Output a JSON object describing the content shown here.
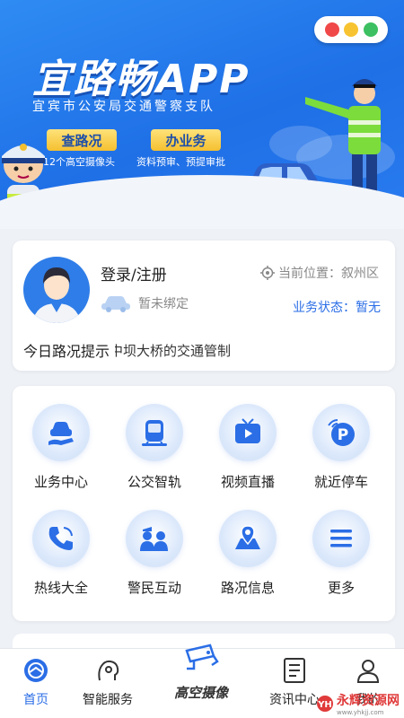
{
  "banner": {
    "title": "宜路畅APP",
    "subtitle": "宜宾市公安局交通警察支队",
    "badges": [
      {
        "label": "查路况",
        "note": "12个高空摄像头"
      },
      {
        "label": "办业务",
        "note": "资料预审、预提审批"
      }
    ],
    "carousel": {
      "count": 3,
      "active": 0
    },
    "colors": {
      "accent": "#2b6ee6",
      "badge": "#f4c030"
    }
  },
  "user": {
    "login_label": "登录/注册",
    "location_label": "当前位置：叙州区",
    "car_status": "暂未绑定",
    "business_status": "业务状态：暂无"
  },
  "notice": {
    "label": "今日路况提示",
    "text": "中坝大桥的交通管制"
  },
  "services": [
    {
      "label": "业务中心",
      "icon": "car-service-icon"
    },
    {
      "label": "公交智轨",
      "icon": "bus-icon"
    },
    {
      "label": "视频直播",
      "icon": "tv-icon"
    },
    {
      "label": "就近停车",
      "icon": "parking-icon"
    },
    {
      "label": "热线大全",
      "icon": "phone-icon"
    },
    {
      "label": "警民互动",
      "icon": "police-interaction-icon"
    },
    {
      "label": "路况信息",
      "icon": "map-pin-icon"
    },
    {
      "label": "更多",
      "icon": "menu-icon"
    }
  ],
  "nav": [
    {
      "label": "首页",
      "icon": "home-icon",
      "active": true
    },
    {
      "label": "智能服务",
      "icon": "smart-service-icon"
    },
    {
      "label": "高空摄像",
      "icon": "camera-icon"
    },
    {
      "label": "资讯中心",
      "icon": "news-icon"
    },
    {
      "label": "我的",
      "icon": "user-icon"
    }
  ],
  "watermark": {
    "text": "永辉资源网",
    "url": "www.yhkjj.com"
  }
}
